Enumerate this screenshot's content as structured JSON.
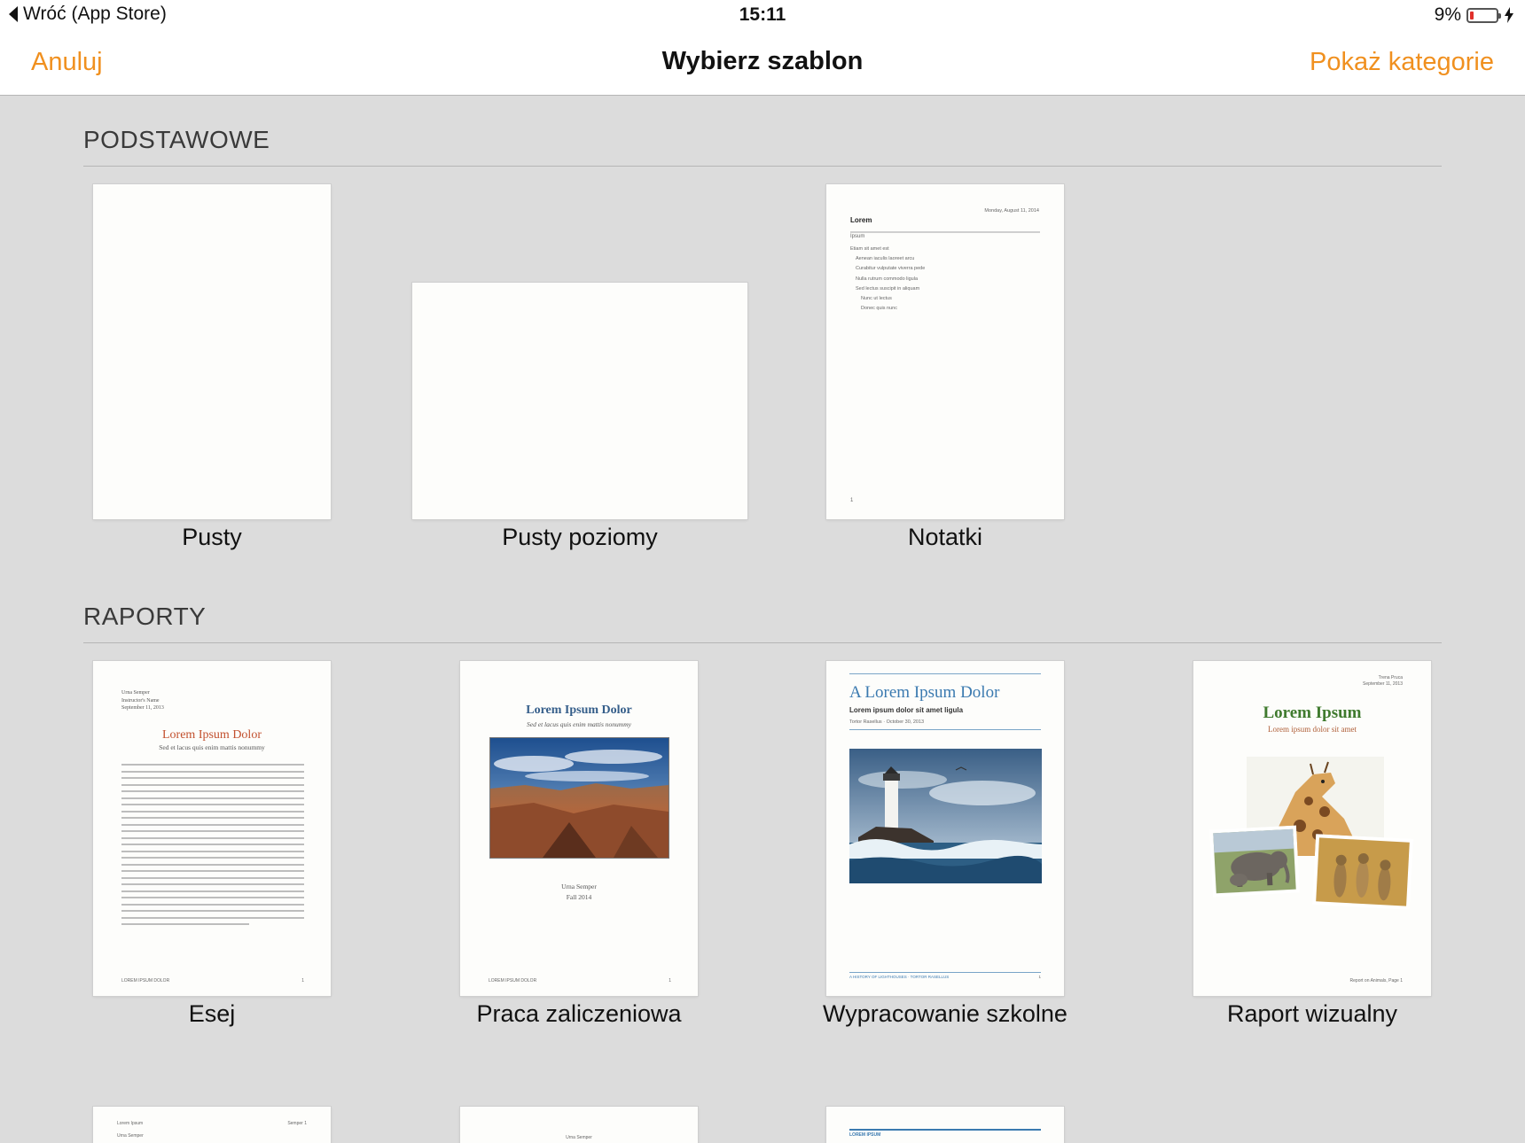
{
  "status_bar": {
    "back_label": "Wróć (App Store)",
    "time": "15:11",
    "battery_percent_label": "9%",
    "battery_level": 0.09,
    "battery_color": "#e0302a"
  },
  "nav": {
    "cancel_label": "Anuluj",
    "title": "Wybierz szablon",
    "categories_label": "Pokaż kategorie",
    "accent_color": "#f0901f"
  },
  "sections": [
    {
      "title": "PODSTAWOWE",
      "templates": [
        {
          "label": "Pusty"
        },
        {
          "label": "Pusty poziomy"
        },
        {
          "label": "Notatki",
          "preview": {
            "date": "Monday, August 11, 2014",
            "heading": "Lorem",
            "subheading": "Ipsum",
            "bullets": [
              "Etiam sit amet est",
              "Aenean iaculis laoreet arcu",
              "Curabitur vulputate viverra pede",
              "Nulla rutrum commodo ligula",
              "Sed lectus suscipit in aliquam",
              "Nunc ut lectus",
              "Donec quis nunc"
            ],
            "page_number": "1"
          }
        }
      ]
    },
    {
      "title": "RAPORTY",
      "templates": [
        {
          "label": "Esej",
          "preview": {
            "author": "Urna Semper",
            "instructor": "Instructor's Name",
            "date": "September 11, 2013",
            "title": "Lorem Ipsum Dolor",
            "subtitle": "Sed et lacus quis enim mattis nonummy",
            "footer": "LOREM IPSUM DOLOR",
            "page_number": "1"
          }
        },
        {
          "label": "Praca zaliczeniowa",
          "preview": {
            "title": "Lorem Ipsum Dolor",
            "subtitle": "Sed et lacus quis enim mattis nonummy",
            "author": "Urna Semper",
            "term": "Fall 2014",
            "footer": "LOREM IPSUM DOLOR",
            "page_number": "1"
          }
        },
        {
          "label": "Wypracowanie szkolne",
          "preview": {
            "title": "A Lorem Ipsum Dolor",
            "subtitle": "Lorem ipsum dolor sit amet ligula",
            "byline": "Tortor Rasellus · October 30, 2013",
            "footer": "A HISTORY OF LIGHTHOUSES · TORTOR RASELLUS",
            "page_number": "1"
          }
        },
        {
          "label": "Raport wizualny",
          "preview": {
            "author": "Trena Pruca",
            "date": "September 11, 2013",
            "title": "Lorem Ipsum",
            "subtitle": "Lorem ipsum dolor sit amet",
            "footer": "Report on Animals, Page 1"
          }
        }
      ]
    }
  ],
  "partial_row": {
    "tile1": {
      "left": "Lorem Ipsum",
      "right": "Semper 1",
      "line2": "Urna Semper"
    },
    "tile2": {
      "line": "Urna Semper"
    },
    "tile3": {
      "line": "LOREM IPSUM"
    }
  }
}
